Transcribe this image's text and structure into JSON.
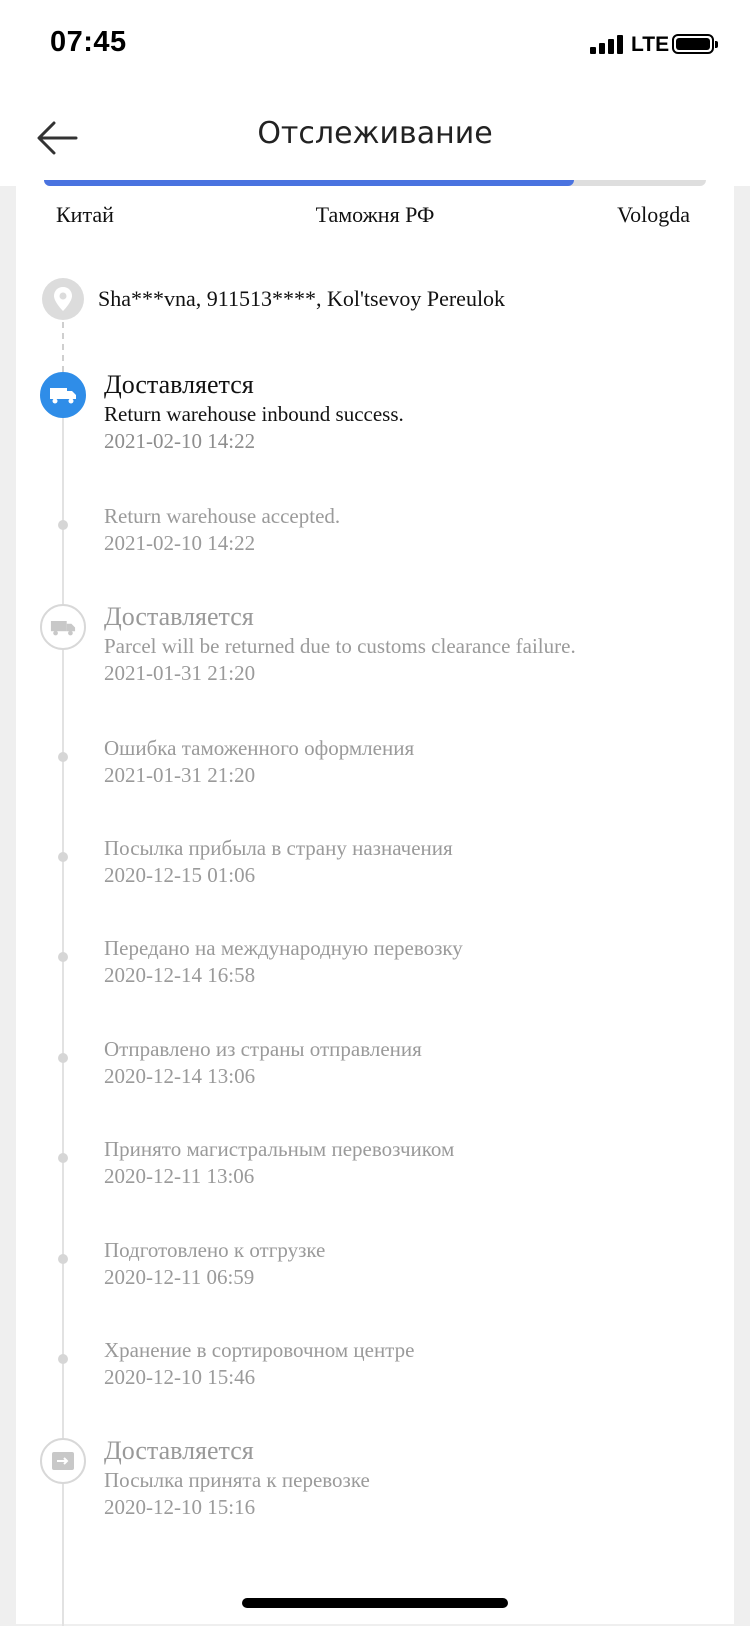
{
  "status_bar": {
    "time": "07:45",
    "network": "LTE"
  },
  "header": {
    "title": "Отслеживание"
  },
  "route": {
    "start": "Китай",
    "middle": "Таможня РФ",
    "end": "Vologda",
    "progress_fraction": 0.8
  },
  "address": "Sha***vna,  911513****,  Kol'tsevoy Pereulok",
  "events": [
    {
      "status": "Доставляется",
      "description": "Return warehouse inbound success.",
      "time": "2021-02-10 14:22",
      "icon": "truck-icon"
    },
    {
      "status": "",
      "description": "Return warehouse accepted.",
      "time": "2021-02-10 14:22",
      "icon": ""
    },
    {
      "status": "Доставляется",
      "description": "Parcel will be returned due to customs clearance failure.",
      "time": "2021-01-31 21:20",
      "icon": "truck-icon"
    },
    {
      "status": "",
      "description": "Ошибка таможенного оформления",
      "time": "2021-01-31 21:20",
      "icon": ""
    },
    {
      "status": "",
      "description": "Посылка прибыла в страну назначения",
      "time": "2020-12-15 01:06",
      "icon": ""
    },
    {
      "status": "",
      "description": "Передано на международную перевозку",
      "time": "2020-12-14 16:58",
      "icon": ""
    },
    {
      "status": "",
      "description": "Отправлено из страны отправления",
      "time": "2020-12-14 13:06",
      "icon": ""
    },
    {
      "status": "",
      "description": "Принято магистральным перевозчиком",
      "time": "2020-12-11 13:06",
      "icon": ""
    },
    {
      "status": "",
      "description": "Подготовлено к отгрузке",
      "time": "2020-12-11 06:59",
      "icon": ""
    },
    {
      "status": "",
      "description": "Хранение в сортировочном центре",
      "time": "2020-12-10 15:46",
      "icon": ""
    },
    {
      "status": "Доставляется",
      "description": "Посылка принята к перевозке",
      "time": "2020-12-10 15:16",
      "icon": "package-icon"
    }
  ],
  "colors": {
    "accent": "#2f8de8",
    "progress": "#4a73e0"
  }
}
